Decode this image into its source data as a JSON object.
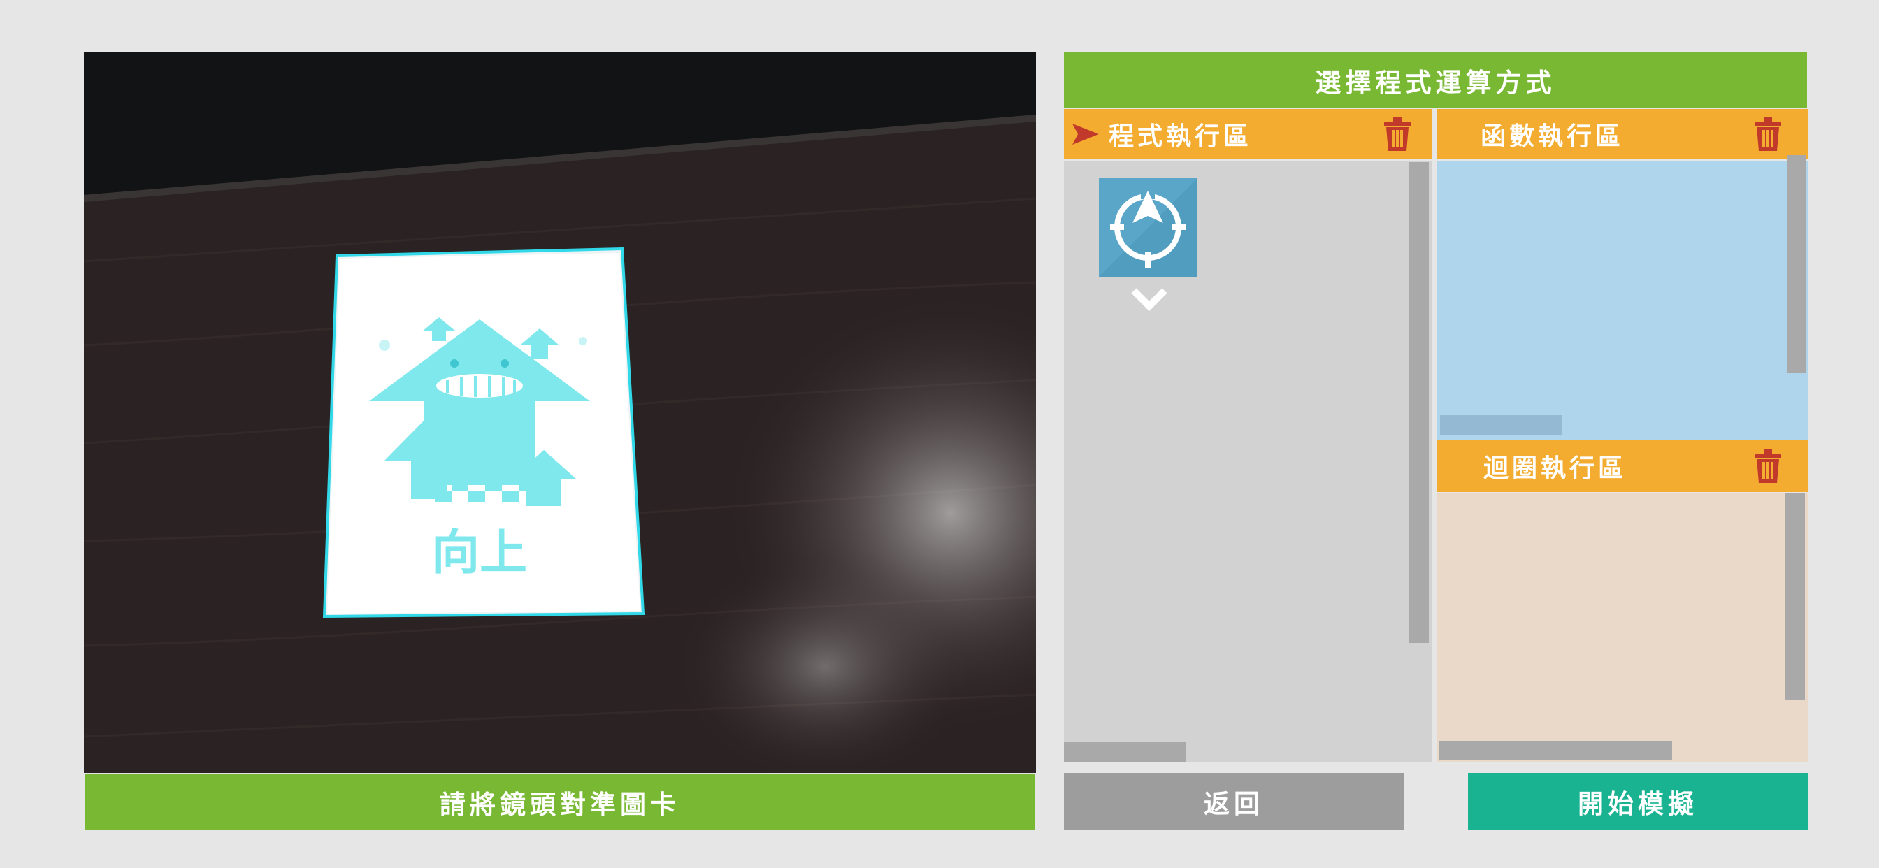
{
  "camera": {
    "card_text": "向上",
    "caption": "請將鏡頭對準圖卡"
  },
  "panel": {
    "title": "選擇程式運算方式",
    "program_zone": {
      "label": "程式執行區",
      "blocks": [
        "compass-up-icon"
      ]
    },
    "function_zone": {
      "label": "函數執行區"
    },
    "loop_zone": {
      "label": "迴圈執行區"
    }
  },
  "buttons": {
    "back": "返回",
    "start": "開始模擬"
  },
  "colors": {
    "green": "#78b833",
    "orange": "#f4ac30",
    "teal": "#1ab392",
    "trash_red": "#c0392b"
  }
}
